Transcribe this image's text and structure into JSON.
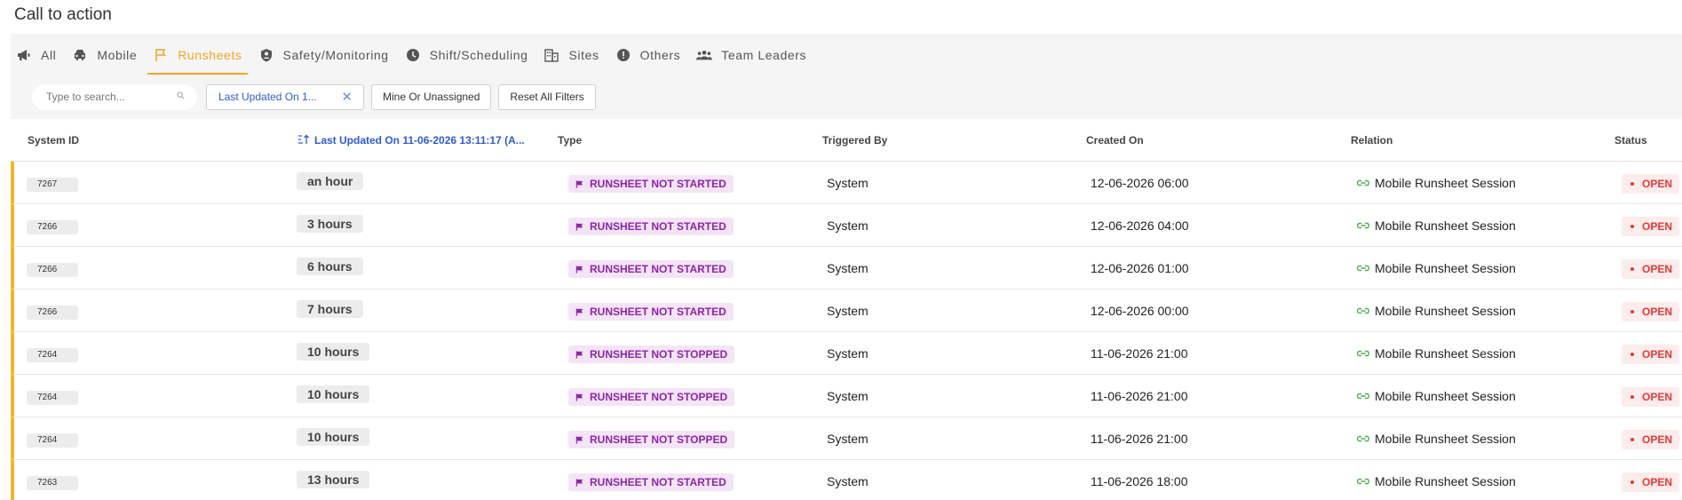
{
  "page": {
    "title": "Call to action"
  },
  "tabs": [
    {
      "label": "All",
      "icon": "megaphone-icon",
      "active": false
    },
    {
      "label": "Mobile",
      "icon": "car-icon",
      "active": false
    },
    {
      "label": "Runsheets",
      "icon": "flag-icon",
      "active": true
    },
    {
      "label": "Safety/Monitoring",
      "icon": "shield-person-icon",
      "active": false
    },
    {
      "label": "Shift/Scheduling",
      "icon": "clock-icon",
      "active": false
    },
    {
      "label": "Sites",
      "icon": "building-icon",
      "active": false
    },
    {
      "label": "Others",
      "icon": "exclamation-icon",
      "active": false
    },
    {
      "label": "Team Leaders",
      "icon": "group-icon",
      "active": false
    }
  ],
  "filters": {
    "search_placeholder": "Type to search...",
    "active_filter_label": "Last Updated On 1...",
    "mine_label": "Mine Or Unassigned",
    "reset_label": "Reset All Filters"
  },
  "table": {
    "columns": {
      "system_id": "System ID",
      "last_updated": "Last Updated On 11-06-2026 13:11:17 (A...",
      "type": "Type",
      "triggered_by": "Triggered By",
      "created_on": "Created On",
      "relation": "Relation",
      "status": "Status"
    },
    "rows": [
      {
        "id": "7267",
        "updated": "an hour",
        "type": "RUNSHEET NOT STARTED",
        "triggered_by": "System",
        "created_on": "12-06-2026 06:00",
        "relation": "Mobile Runsheet Session",
        "status": "OPEN"
      },
      {
        "id": "7266",
        "updated": "3 hours",
        "type": "RUNSHEET NOT STARTED",
        "triggered_by": "System",
        "created_on": "12-06-2026 04:00",
        "relation": "Mobile Runsheet Session",
        "status": "OPEN"
      },
      {
        "id": "7266",
        "updated": "6 hours",
        "type": "RUNSHEET NOT STARTED",
        "triggered_by": "System",
        "created_on": "12-06-2026 01:00",
        "relation": "Mobile Runsheet Session",
        "status": "OPEN"
      },
      {
        "id": "7266",
        "updated": "7 hours",
        "type": "RUNSHEET NOT STARTED",
        "triggered_by": "System",
        "created_on": "12-06-2026 00:00",
        "relation": "Mobile Runsheet Session",
        "status": "OPEN"
      },
      {
        "id": "7264",
        "updated": "10 hours",
        "type": "RUNSHEET NOT STOPPED",
        "triggered_by": "System",
        "created_on": "11-06-2026 21:00",
        "relation": "Mobile Runsheet Session",
        "status": "OPEN"
      },
      {
        "id": "7264",
        "updated": "10 hours",
        "type": "RUNSHEET NOT STOPPED",
        "triggered_by": "System",
        "created_on": "11-06-2026 21:00",
        "relation": "Mobile Runsheet Session",
        "status": "OPEN"
      },
      {
        "id": "7264",
        "updated": "10 hours",
        "type": "RUNSHEET NOT STOPPED",
        "triggered_by": "System",
        "created_on": "11-06-2026 21:00",
        "relation": "Mobile Runsheet Session",
        "status": "OPEN"
      },
      {
        "id": "7263",
        "updated": "13 hours",
        "type": "RUNSHEET NOT STARTED",
        "triggered_by": "System",
        "created_on": "11-06-2026 18:00",
        "relation": "Mobile Runsheet Session",
        "status": "OPEN"
      }
    ]
  },
  "colors": {
    "accent": "#f5a623",
    "row_marker": "#f5b71f",
    "link_blue": "#2f5bd8",
    "type_badge_text": "#8e24aa",
    "type_badge_bg": "#f3e5f5",
    "status_open_text": "#e53935",
    "status_open_bg": "#fdecec",
    "relation_icon": "#4caf50"
  }
}
